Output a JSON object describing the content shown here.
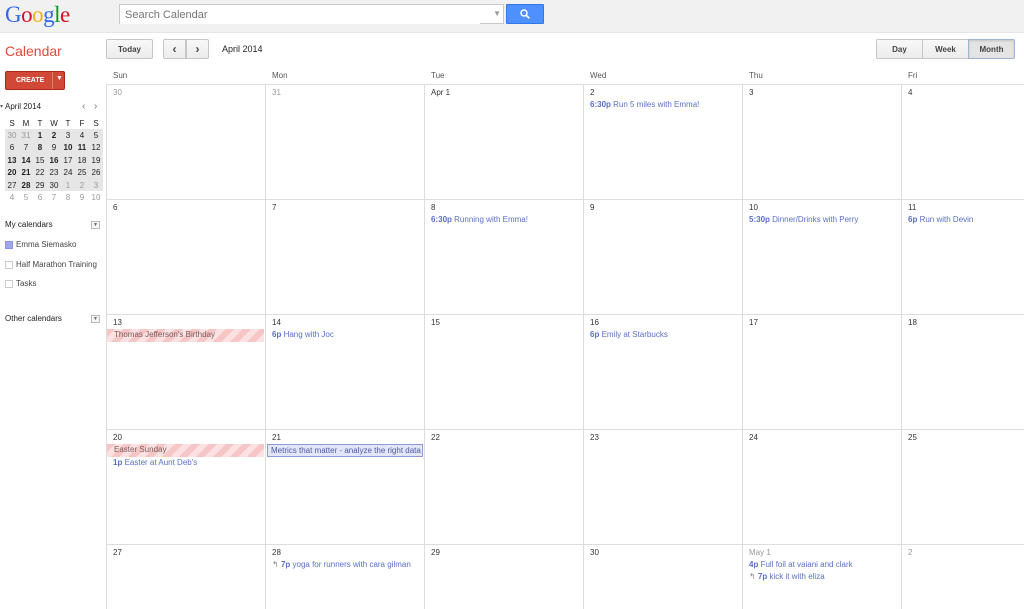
{
  "logo": {
    "letters": [
      "G",
      "o",
      "o",
      "g",
      "l",
      "e"
    ]
  },
  "search": {
    "placeholder": "Search Calendar"
  },
  "toolbar": {
    "app_title": "Calendar",
    "today": "Today",
    "prev": "‹",
    "next": "›",
    "date_label": "April 2014",
    "views": [
      "Day",
      "Week",
      "Month"
    ],
    "active_view": "Month"
  },
  "sidebar": {
    "create": "CREATE",
    "mini_cal": {
      "title": "April 2014",
      "days_header": [
        "S",
        "M",
        "T",
        "W",
        "T",
        "F",
        "S"
      ],
      "weeks": [
        [
          "30",
          "31",
          "1",
          "2",
          "3",
          "4",
          "5"
        ],
        [
          "6",
          "7",
          "8",
          "9",
          "10",
          "11",
          "12"
        ],
        [
          "13",
          "14",
          "15",
          "16",
          "17",
          "18",
          "19"
        ],
        [
          "20",
          "21",
          "22",
          "23",
          "24",
          "25",
          "26"
        ],
        [
          "27",
          "28",
          "29",
          "30",
          "1",
          "2",
          "3"
        ],
        [
          "4",
          "5",
          "6",
          "7",
          "8",
          "9",
          "10"
        ]
      ]
    },
    "my_calendars_label": "My calendars",
    "my_calendars": [
      {
        "name": "Emma Siemasko",
        "color": "#9fa8ee"
      },
      {
        "name": "Half Marathon Training",
        "color": "#ffffff"
      },
      {
        "name": "Tasks",
        "color": "#ffffff"
      }
    ],
    "other_calendars_label": "Other calendars"
  },
  "grid": {
    "days_of_week": [
      "Sun",
      "Mon",
      "Tue",
      "Wed",
      "Thu",
      "Fri"
    ],
    "weeks": [
      [
        "30",
        "31",
        "Apr 1",
        "2",
        "3",
        "4"
      ],
      [
        "6",
        "7",
        "8",
        "9",
        "10",
        "11"
      ],
      [
        "13",
        "14",
        "15",
        "16",
        "17",
        "18"
      ],
      [
        "20",
        "21",
        "22",
        "23",
        "24",
        "25"
      ],
      [
        "27",
        "28",
        "29",
        "30",
        "May 1",
        "2"
      ]
    ],
    "events": [
      {
        "week": 0,
        "day": 3,
        "time": "6:30p",
        "title": "Run 5 miles with Emma!"
      },
      {
        "week": 1,
        "day": 2,
        "time": "6:30p",
        "title": "Running with Emma!"
      },
      {
        "week": 1,
        "day": 4,
        "time": "5:30p",
        "title": "Dinner/Drinks with Perry"
      },
      {
        "week": 1,
        "day": 5,
        "time": "6p",
        "title": "Run with Devin"
      },
      {
        "week": 2,
        "day": 1,
        "time": "6p",
        "title": "Hang with Joc"
      },
      {
        "week": 2,
        "day": 3,
        "time": "6p",
        "title": "Emily at Starbucks"
      },
      {
        "week": 3,
        "day": 0,
        "time": "1p",
        "title": "Easter at Aunt Deb's"
      },
      {
        "week": 4,
        "day": 1,
        "time": "7p",
        "title": "yoga for runners with cara gilman"
      },
      {
        "week": 4,
        "day": 4,
        "time": "4p",
        "title": "Full foil at vaiani and clark"
      },
      {
        "week": 4,
        "day": 4,
        "time": "7p",
        "title": "kick it with eliza"
      }
    ],
    "allday": {
      "jefferson": "Thomas Jefferson's Birthday",
      "easter": "Easter Sunday",
      "metrics": "Metrics that matter - analyze the right data"
    }
  }
}
